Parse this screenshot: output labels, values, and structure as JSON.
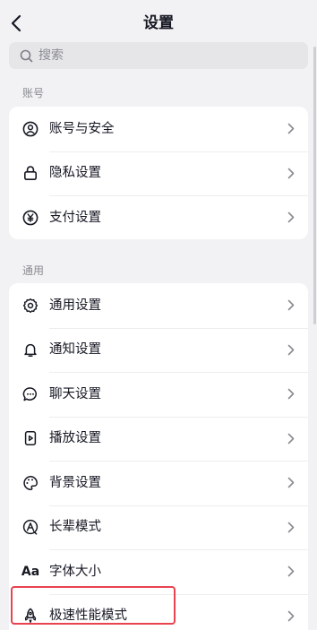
{
  "header": {
    "title": "设置",
    "back_icon": "chevron-left-icon"
  },
  "search": {
    "placeholder": "搜索",
    "icon": "search-icon"
  },
  "sections": [
    {
      "label": "账号",
      "items": [
        {
          "label": "账号与安全",
          "icon": "user-circle-icon"
        },
        {
          "label": "隐私设置",
          "icon": "lock-icon"
        },
        {
          "label": "支付设置",
          "icon": "yen-circle-icon"
        }
      ]
    },
    {
      "label": "通用",
      "items": [
        {
          "label": "通用设置",
          "icon": "gear-icon"
        },
        {
          "label": "通知设置",
          "icon": "bell-icon"
        },
        {
          "label": "聊天设置",
          "icon": "chat-bubble-icon"
        },
        {
          "label": "播放设置",
          "icon": "play-icon"
        },
        {
          "label": "背景设置",
          "icon": "palette-icon"
        },
        {
          "label": "长辈模式",
          "icon": "elder-mode-icon"
        },
        {
          "label": "字体大小",
          "icon": "font-size-icon",
          "icon_text": "Aa"
        },
        {
          "label": "极速性能模式",
          "icon": "rocket-icon"
        }
      ]
    }
  ],
  "colors": {
    "background": "#f2f2f4",
    "card": "#ffffff",
    "text": "#161823",
    "muted": "#8a8b91",
    "highlight": "#e8434f"
  }
}
